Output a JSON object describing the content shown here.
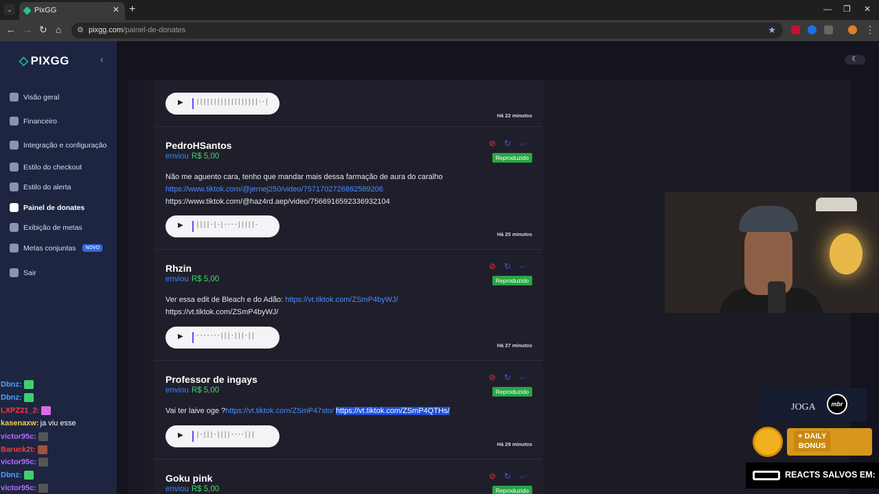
{
  "browser": {
    "tab_title": "PixGG",
    "url_host": "pixgg.com",
    "url_path": "/painel-de-donates"
  },
  "app": {
    "logo": "PIXGG",
    "nav": [
      {
        "label": "Visão geral",
        "icon": "home-icon"
      },
      {
        "label": "Financeiro",
        "icon": "wallet-icon"
      },
      {
        "label": "Integração e configuração",
        "icon": "integration-icon"
      },
      {
        "label": "Estilo do checkout",
        "icon": "palette-icon"
      },
      {
        "label": "Estilo do alerta",
        "icon": "alert-style-icon"
      },
      {
        "label": "Painel de donates",
        "icon": "donate-hand-icon"
      },
      {
        "label": "Exibição de metas",
        "icon": "star-icon"
      },
      {
        "label": "Metas conjuntas",
        "icon": "rocket-icon",
        "badge": "NOVO"
      },
      {
        "label": "Sair",
        "icon": "logout-icon"
      }
    ]
  },
  "chat": [
    {
      "user": "Dbnz:",
      "color": "#4aa3ff",
      "msg": ""
    },
    {
      "user": "Dbnz:",
      "color": "#4aa3ff",
      "msg": ""
    },
    {
      "user": "LXPZ21_2:",
      "color": "#ff3a3a",
      "msg": ""
    },
    {
      "user": "kasenaxw:",
      "color": "#f0d048",
      "msg": "ja viu esse"
    },
    {
      "user": "victor95c:",
      "color": "#b36bff",
      "msg": ""
    },
    {
      "user": "Baruck2t:",
      "color": "#ff3a3a",
      "msg": ""
    },
    {
      "user": "victor95c:",
      "color": "#b36bff",
      "msg": ""
    },
    {
      "user": "Dbnz:",
      "color": "#4aa3ff",
      "msg": ""
    },
    {
      "user": "victor95c:",
      "color": "#b36bff",
      "msg": ""
    }
  ],
  "donations": {
    "sent_label": "enviou",
    "status_label": "Reproduzido",
    "items": [
      {
        "name": "",
        "amount": "",
        "message": [],
        "time": "Há 22 minutos"
      },
      {
        "name": "PedroHSantos",
        "amount": "R$ 5,00",
        "message": [
          {
            "text": "Não me aguento cara, tenho que mandar mais dessa farmação de aura do caralho",
            "type": "text"
          },
          {
            "text": "https://www.tiktok.com/@jernej250/video/7571702726862589206",
            "type": "link"
          },
          {
            "text": "https://www.tiktok.com/@haz4rd.aep/video/7566916592336932104",
            "type": "text"
          }
        ],
        "time": "Há 25 minutos"
      },
      {
        "name": "Rhzin",
        "amount": "R$ 5,00",
        "message_prefix": "Ver essa edit de Bleach e do Adão: ",
        "message_link": "https://vt.tiktok.com/ZSmP4byWJ/",
        "message_line2": "https://vt.tiktok.com/ZSmP4byWJ/",
        "time": "Há 27 minutos"
      },
      {
        "name": "Professor de ingays",
        "amount": "R$ 5,00",
        "message_prefix": "Vai ter laive oge ?",
        "message_link": "https://vt.tiktok.com/ZSmP47sto/",
        "message_selected": "https://vt.tiktok.com/ZSmP4QTHs/",
        "time": "Há 29 minutos"
      },
      {
        "name": "Goku pink",
        "amount": "R$ 5,00"
      }
    ]
  },
  "overlays": {
    "sponsor_text": "JOGA",
    "sponsor_badge": "mbr",
    "bonus_label_1": "+ DAILY",
    "bonus_label_2": "BONUS",
    "reacts_text": "REACTS SALVOS EM:"
  },
  "colors": {
    "brand": "#23c48e",
    "sidebar": "#1d2541",
    "link": "#4a8dff",
    "amount": "#3ddc64",
    "status": "#28a745"
  }
}
